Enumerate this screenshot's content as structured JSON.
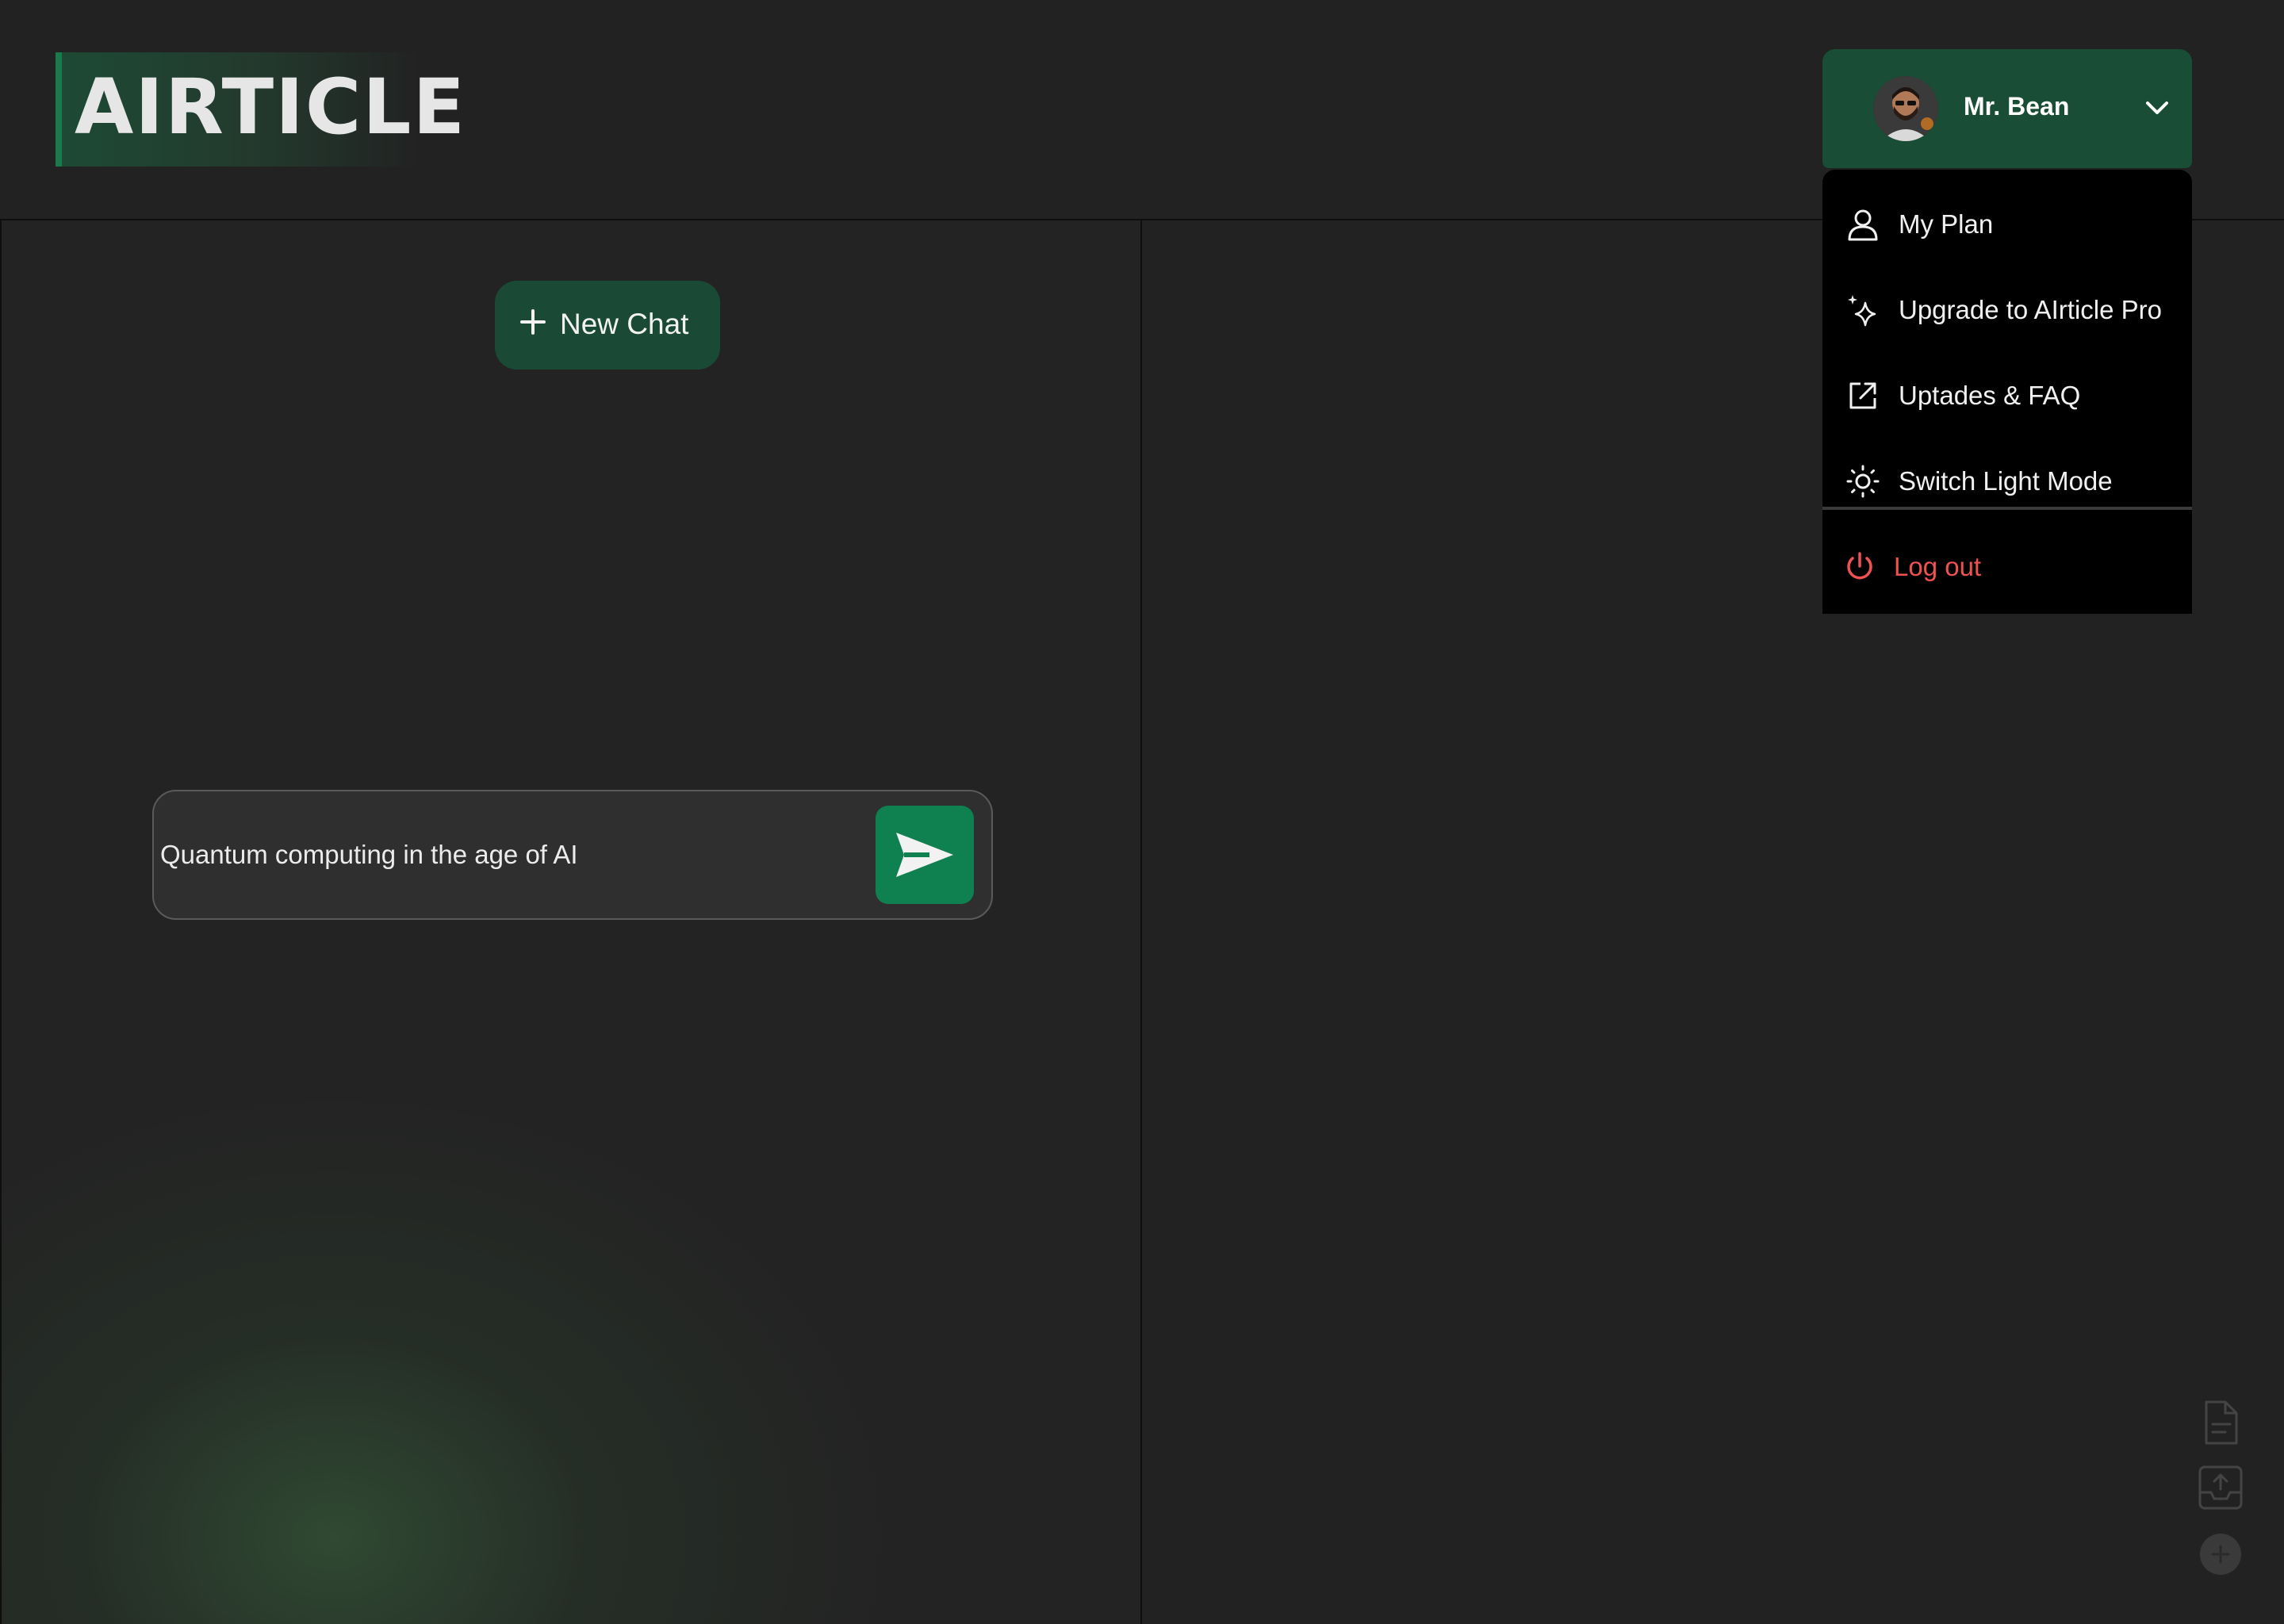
{
  "header": {
    "logo_text": "AIRTICLE",
    "user": {
      "name": "Mr. Bean",
      "avatar_icon": "avatar-photo",
      "dropdown_icon": "chevron-down-icon"
    }
  },
  "menu": {
    "items": [
      {
        "label": "My Plan",
        "icon": "user-icon"
      },
      {
        "label": "Upgrade to AIrticle Pro",
        "icon": "sparkles-icon"
      },
      {
        "label": "Uptades & FAQ",
        "icon": "external-link-icon"
      },
      {
        "label": "Switch Light Mode",
        "icon": "sun-icon"
      }
    ],
    "logout": {
      "label": "Log out",
      "icon": "power-icon"
    }
  },
  "sidebar": {
    "new_chat_label": "New Chat",
    "new_chat_icon": "plus-icon"
  },
  "prompt": {
    "value": "Quantum computing in the age of AI",
    "send_icon": "send-icon"
  },
  "tools": {
    "items": [
      {
        "icon": "document-icon"
      },
      {
        "icon": "upload-tray-icon"
      },
      {
        "icon": "add-circle-icon"
      }
    ]
  },
  "colors": {
    "background": "#222222",
    "accent_green": "#1a4d36",
    "send_green": "#0f8050",
    "logout_red": "#f05252",
    "menu_bg": "#000000"
  }
}
